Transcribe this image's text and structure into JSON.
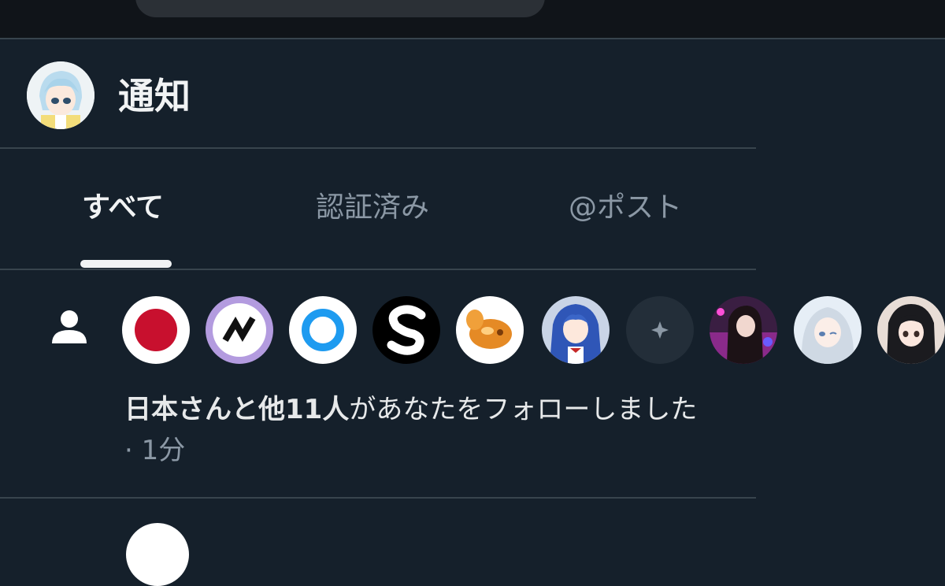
{
  "header": {
    "title": "通知",
    "profile_avatar": "user-avatar"
  },
  "tabs": [
    {
      "label": "すべて",
      "active": true
    },
    {
      "label": "認証済み",
      "active": false
    },
    {
      "label": "@ポスト",
      "active": false
    }
  ],
  "notification": {
    "type_icon": "person-icon",
    "avatars": [
      "japan-flag-avatar",
      "zigzag-logo-avatar",
      "blue-ring-avatar",
      "s-logo-avatar",
      "orange-creature-avatar",
      "blue-hair-girl-avatar",
      "sparkle-default-avatar",
      "dark-hair-girl-avatar",
      "white-hair-girl-avatar",
      "black-hair-girl-avatar"
    ],
    "actor": "日本さん",
    "others": "と他11人",
    "action": "があなたをフォローしました",
    "separator": "·",
    "time": "1分"
  },
  "colors": {
    "background": "#15202b",
    "divider": "#38444d",
    "text_primary": "#e7e9ea",
    "text_secondary": "#8b98a5"
  }
}
